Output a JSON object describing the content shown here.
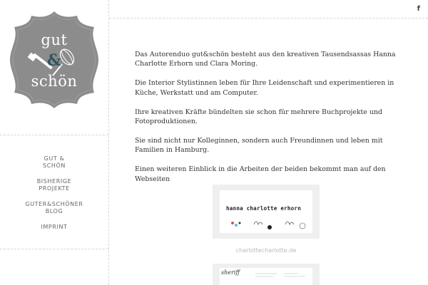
{
  "logo": {
    "line1": "gut",
    "line2": "&",
    "line3": "schön"
  },
  "nav": {
    "items": [
      {
        "label": "GUT &\nSCHÖN"
      },
      {
        "label": "BISHERIGE\nPROJEKTE"
      },
      {
        "label": "GUTER&SCHÖNER\nBLOG"
      },
      {
        "label": "IMPRINT"
      }
    ]
  },
  "header": {
    "facebook_icon": "facebook-icon",
    "facebook_label": "f"
  },
  "content": {
    "paragraphs": [
      "Das Autorenduo gut&schön besteht aus den kreativen Tausendsassas Hanna Charlotte Erhorn und Clara Moring.",
      "Die Interior Stylistinnen leben für Ihre Leidenschaft und experimentieren in Küche, Werkstatt und am Computer.",
      "Ihre kreativen Kräfte bündelten sie schon für mehrere Buchprojekte und Fotoproduktionen.",
      "Sie sind nicht nur Kolleginnen, sondern auch Freundinnen und leben mit Familien in Hamburg.",
      "Einen weiteren Einblick in die Arbeiten der beiden bekommt man auf den Webseiten"
    ]
  },
  "sites": [
    {
      "card_name": "hanna charlotte erhorn",
      "caption": "charlottecharlotte.de"
    },
    {
      "card_name": "sheriff"
    }
  ],
  "colors": {
    "logo_gray": "#8c8c8c",
    "accent_teal": "#2e5660"
  }
}
